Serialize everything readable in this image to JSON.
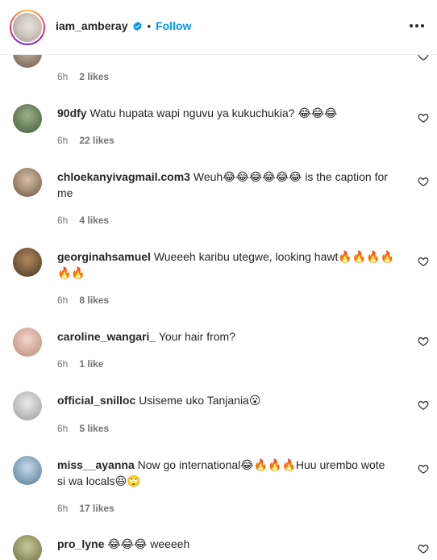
{
  "header": {
    "username": "iam_amberay",
    "separator": "•",
    "follow_label": "Follow"
  },
  "partial_comment": {
    "time": "6h",
    "likes": "2 likes"
  },
  "comments": [
    {
      "username": "90dfy",
      "text": "Watu hupata wapi nguvu ya kukuchukia? 😂😂😂",
      "time": "6h",
      "likes": "22 likes",
      "avatar_color": "#6f8a5b"
    },
    {
      "username": "chloekanyivagmail.com3",
      "text": "Weuh😂😂😂😂😂😂 is the caption for me",
      "time": "6h",
      "likes": "4 likes",
      "avatar_color": "#b39a82"
    },
    {
      "username": "georginahsamuel",
      "text": "Wueeeh karibu utegwe, looking hawt🔥🔥🔥🔥🔥🔥",
      "time": "6h",
      "likes": "8 likes",
      "avatar_color": "#7a5a3a"
    },
    {
      "username": "caroline_wangari_",
      "text": "Your hair from?",
      "time": "6h",
      "likes": "1 like",
      "avatar_color": "#d9b3a6"
    },
    {
      "username": "official_snilloc",
      "text": "Usiseme uko Tanjania😮",
      "time": "6h",
      "likes": "5 likes",
      "avatar_color": "#c8c8c8"
    },
    {
      "username": "miss__ayanna",
      "text": "Now go international😂🔥🔥🔥Huu urembo wote si wa locals😆🙄",
      "time": "6h",
      "likes": "17 likes",
      "avatar_color": "#7fa3c0"
    },
    {
      "username": "pro_lyne",
      "text": "😂😂😂 weeeeh",
      "time": "",
      "likes": "",
      "avatar_color": "#9a9a6a"
    }
  ]
}
